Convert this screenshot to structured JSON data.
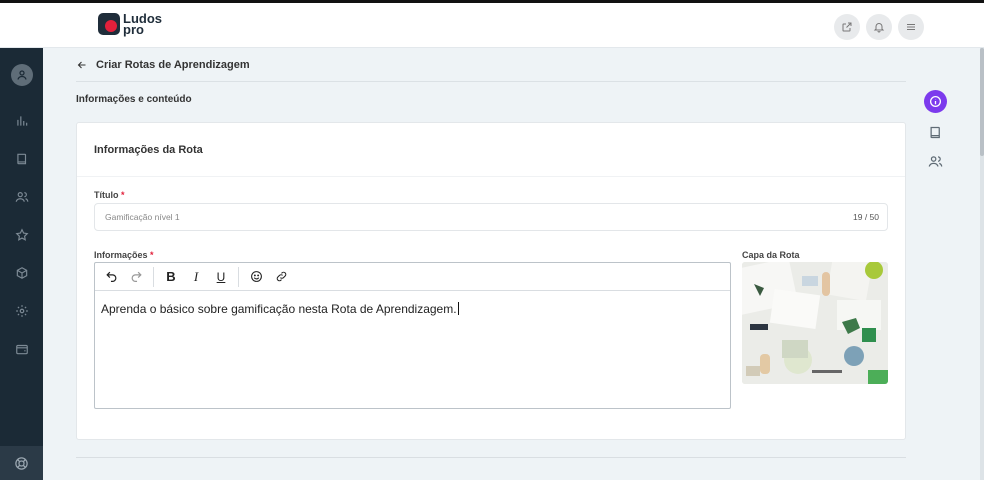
{
  "brand": {
    "line1": "Ludos",
    "line2": "pro"
  },
  "header": {
    "actions": [
      {
        "icon": "external-link-icon"
      },
      {
        "icon": "bell-icon"
      },
      {
        "icon": "menu-icon"
      }
    ]
  },
  "sidebar": {
    "items": [
      {
        "icon": "user-icon"
      },
      {
        "icon": "bar-chart-icon"
      },
      {
        "icon": "book-icon"
      },
      {
        "icon": "users-icon"
      },
      {
        "icon": "star-icon"
      },
      {
        "icon": "box-icon"
      },
      {
        "icon": "settings-icon"
      },
      {
        "icon": "wallet-icon"
      }
    ],
    "bottom_icon": "lifebuoy-icon"
  },
  "page": {
    "back_label": "Criar Rotas de Aprendizagem",
    "section_label": "Informações e conteúdo"
  },
  "card": {
    "title": "Informações da Rota",
    "title_field": {
      "label": "Título",
      "required_mark": "*",
      "placeholder": "Gamificação nível 1",
      "counter": "19 / 50"
    },
    "info_field": {
      "label": "Informações",
      "required_mark": "*",
      "content": "Aprenda o básico sobre gamificação nesta Rota de Aprendizagem."
    },
    "toolbar": {
      "undo": "undo-icon",
      "redo": "redo-icon",
      "bold": "B",
      "italic": "I",
      "underline": "U",
      "emoji": "emoji-icon",
      "link": "link-icon"
    },
    "cover_label": "Capa da Rota"
  },
  "right_rail": [
    {
      "icon": "info-icon",
      "active": true
    },
    {
      "icon": "book-icon",
      "active": false
    },
    {
      "icon": "users-icon",
      "active": false
    }
  ],
  "colors": {
    "sidebar_bg": "#1b2a36",
    "accent": "#7c3aed",
    "brand_red": "#e2203b",
    "required": "#e2203b"
  }
}
